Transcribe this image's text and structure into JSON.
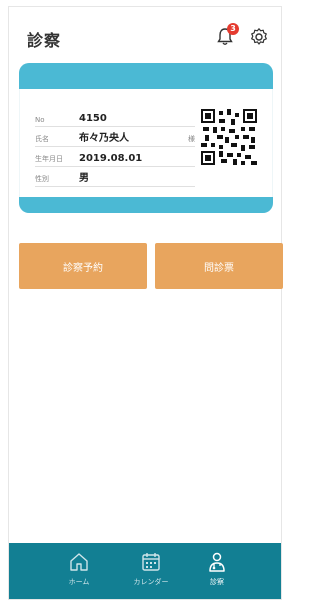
{
  "header": {
    "title": "診察",
    "notification_count": "3"
  },
  "card": {
    "rows": [
      {
        "label": "No",
        "value": "4150",
        "tail": ""
      },
      {
        "label": "氏名",
        "value": "布々乃央人",
        "tail": "様"
      },
      {
        "label": "生年月日",
        "value": "2019.08.01",
        "tail": ""
      },
      {
        "label": "性別",
        "value": "男",
        "tail": ""
      }
    ]
  },
  "buttons": {
    "left": "診察予約",
    "right": "問診票"
  },
  "tabbar": {
    "items": [
      {
        "label": "ホーム",
        "icon": "home-icon"
      },
      {
        "label": "カレンダー",
        "icon": "calendar-icon"
      },
      {
        "label": "診察",
        "icon": "doctor-icon"
      }
    ],
    "active_index": 2
  },
  "colors": {
    "accent": "#4bb9d4",
    "button": "#e8a55e",
    "tabbar": "#127f93",
    "badge": "#e53b2f"
  }
}
